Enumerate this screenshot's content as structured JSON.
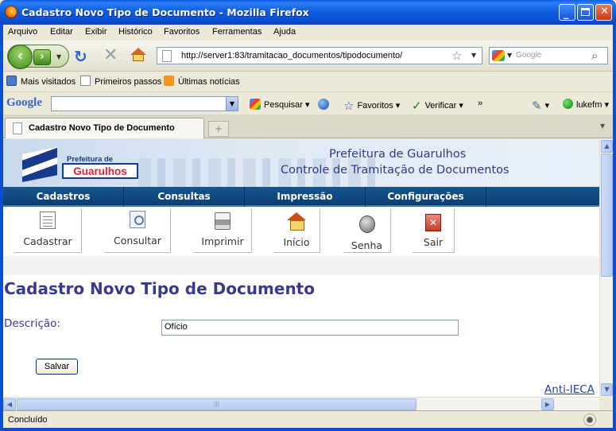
{
  "window": {
    "title": "Cadastro Novo Tipo de Documento - Mozilla Firefox"
  },
  "menubar": [
    "Arquivo",
    "Editar",
    "Exibir",
    "Histórico",
    "Favoritos",
    "Ferramentas",
    "Ajuda"
  ],
  "navigation": {
    "url": "http://server1:83/tramitacao_documentos/tipodocumento/",
    "search_placeholder": "Google"
  },
  "bookmarks": [
    "Mais visitados",
    "Primeiros passos",
    "Últimas notícias"
  ],
  "google_toolbar": {
    "logo": "Google",
    "search_label": "Pesquisar",
    "favorites_label": "Favoritos",
    "spellcheck_label": "Verificar",
    "more": "»",
    "user": "lukefm"
  },
  "tab": {
    "title": "Cadastro Novo Tipo de Documento",
    "new_tab": "+"
  },
  "page": {
    "logo_line1": "Prefeitura de",
    "logo_line2": "Guarulhos",
    "header_line1": "Prefeitura de Guarulhos",
    "header_line2": "Controle de Tramitação de Documentos",
    "menu": [
      "Cadastros",
      "Consultas",
      "Impressão",
      "Configurações"
    ],
    "actions": [
      "Cadastrar",
      "Consultar",
      "Imprimir",
      "Início",
      "Senha",
      "Sair"
    ],
    "title": "Cadastro Novo Tipo de Documento",
    "form": {
      "description_label": "Descrição:",
      "description_value": "Ofício",
      "save_label": "Salvar"
    },
    "footer_link": "Anti-IECA"
  },
  "status": {
    "text": "Concluído"
  },
  "colors": {
    "titlebar": "#0b4fd0",
    "menu_bar": "#0c3f72",
    "heading": "#3a3a8c"
  }
}
